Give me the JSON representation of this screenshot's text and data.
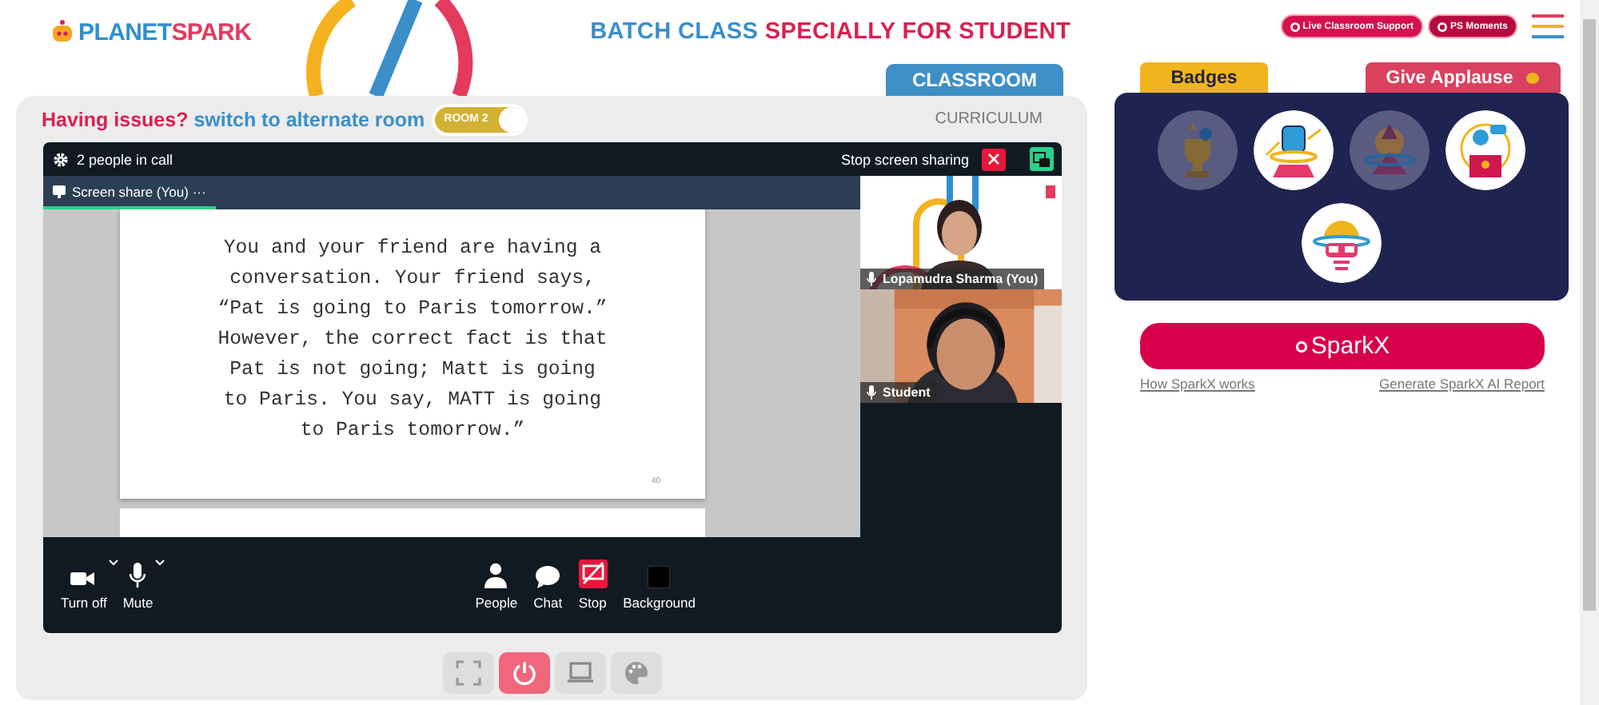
{
  "header": {
    "logo_text": [
      "PLANET",
      "SPARK"
    ],
    "title_parts": [
      "BATCH CLASS",
      "SPECIALLY FOR STUDENT"
    ],
    "buttons": [
      {
        "label": "Live Classroom Support"
      },
      {
        "label": "PS Moments"
      }
    ]
  },
  "tabs": [
    {
      "label": "CLASSROOM",
      "selected": true
    },
    {
      "label": "CURRICULUM",
      "selected": false
    }
  ],
  "room_notice": {
    "text": "Having issues?",
    "link": "switch to alternate room",
    "toggle": {
      "label": "ROOM 2",
      "on": true
    }
  },
  "call": {
    "people": "2 people in call",
    "stop_sharing": "Stop screen sharing",
    "tab": {
      "label": "Screen share (You)",
      "more": "···",
      "selected": true
    },
    "slide": {
      "text": "You and your friend are having a conversation. Your friend says, “Pat is going to Paris tomorrow.” However, the correct fact is that Pat is not going; Matt is going to Paris. You say, MATT is going to Paris tomorrow.”",
      "page": "40"
    },
    "participants": [
      {
        "name": "Lopamudra Sharma (You)",
        "kind": "teacher"
      },
      {
        "name": "Student",
        "kind": "student"
      }
    ],
    "controls": [
      {
        "label": "Turn off",
        "kind": "camera",
        "dropdown": true
      },
      {
        "label": "Mute",
        "kind": "mic",
        "dropdown": true
      },
      {
        "label": "People",
        "kind": "people",
        "dropdown": false
      },
      {
        "label": "Chat",
        "kind": "chat",
        "dropdown": false
      },
      {
        "label": "Stop",
        "kind": "stop",
        "dropdown": false
      },
      {
        "label": "Background",
        "kind": "background",
        "dropdown": false
      }
    ]
  },
  "toolbar": [
    {
      "kind": "fullscreen",
      "selected": false
    },
    {
      "kind": "power",
      "selected": true
    },
    {
      "kind": "screen",
      "selected": false
    },
    {
      "kind": "palette",
      "selected": false
    }
  ],
  "side_tabs": [
    {
      "label": "Badges",
      "selected": true
    },
    {
      "label": "Give Applause",
      "selected": false
    }
  ],
  "badges": [
    {
      "kind": "trophy",
      "earned": false
    },
    {
      "kind": "fist",
      "earned": true
    },
    {
      "kind": "wizard",
      "earned": false
    },
    {
      "kind": "speaker",
      "earned": true
    },
    {
      "kind": "brain",
      "earned": true
    }
  ],
  "sparkx": {
    "label": "SparkX",
    "links": [
      "How SparkX works",
      "Generate SparkX AI Report"
    ]
  }
}
